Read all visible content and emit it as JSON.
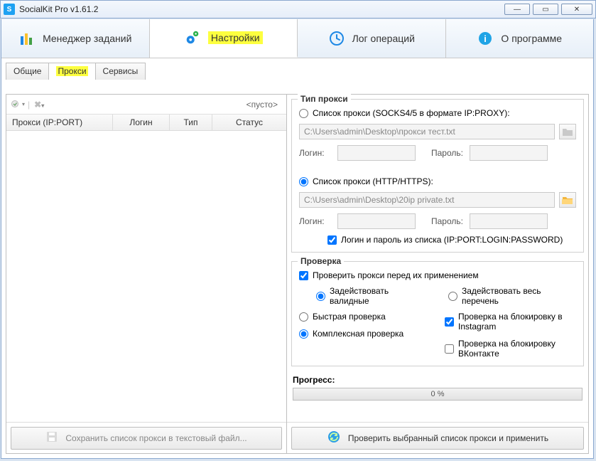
{
  "window": {
    "title": "SocialKit Pro v1.61.2"
  },
  "mainTabs": {
    "tasks": "Менеджер заданий",
    "settings": "Настройки",
    "log": "Лог операций",
    "about": "О программе"
  },
  "subTabs": {
    "general": "Общие",
    "proxy": "Прокси",
    "services": "Сервисы"
  },
  "leftPanel": {
    "empty": "<пусто>",
    "cols": {
      "ipport": "Прокси (IP:PORT)",
      "login": "Логин",
      "type": "Тип",
      "status": "Статус"
    },
    "saveBtn": "Сохранить список прокси в текстовый файл..."
  },
  "proxyType": {
    "legend": "Тип прокси",
    "socksLabel": "Список прокси (SOCKS4/5 в формате IP:PROXY):",
    "socksPath": "C:\\Users\\admin\\Desktop\\прокси тест.txt",
    "httpLabel": "Список прокси (HTTP/HTTPS):",
    "httpPath": "C:\\Users\\admin\\Desktop\\20ip private.txt",
    "login": "Логин:",
    "password": "Пароль:",
    "credsFromList": "Логин и пароль из списка (IP:PORT:LOGIN:PASSWORD)"
  },
  "check": {
    "legend": "Проверка",
    "before": "Проверить прокси перед их применением",
    "useValid": "Задействовать валидные",
    "useAll": "Задействовать весь перечень",
    "fast": "Быстрая проверка",
    "complex": "Комплексная проверка",
    "instagram": "Проверка на блокировку в Instagram",
    "vk": "Проверка на блокировку ВКонтакте"
  },
  "progress": {
    "label": "Прогресс:",
    "text": "0 %"
  },
  "applyBtn": "Проверить выбранный список прокси и применить"
}
